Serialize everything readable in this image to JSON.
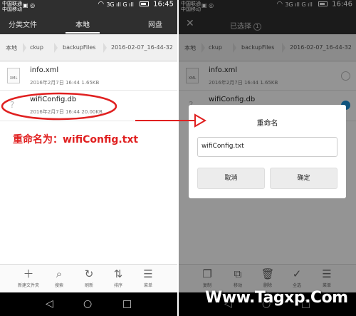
{
  "status": {
    "carrier1": "中国联通",
    "carrier2": "中国移动",
    "signal": "3G ıll G ıll",
    "time_left": "16:45",
    "time_right": "16:46"
  },
  "tabs": [
    {
      "label": "分类文件"
    },
    {
      "label": "本地"
    },
    {
      "label": "网盘"
    }
  ],
  "selection": {
    "title": "已选择",
    "count": "1",
    "close_icon": "close-icon"
  },
  "breadcrumb": [
    "本地",
    "ckup",
    "backupFiles",
    "2016-02-07_16-44-32"
  ],
  "files": [
    {
      "name": "info.xml",
      "meta": "2016年2月7日 16:44 1.65KB",
      "icon_label": "XML"
    },
    {
      "name": "wifiConfig.db",
      "meta": "2016年2月7日 16:44 20.00KB",
      "icon_label": "?"
    }
  ],
  "annotation": {
    "note": "重命名为：wifiConfig.txt",
    "color": "#e02020"
  },
  "toolbar_left": [
    {
      "icon": "plus-icon",
      "label": "新建文件夹"
    },
    {
      "icon": "search-icon",
      "label": "搜索"
    },
    {
      "icon": "refresh-icon",
      "label": "刷新"
    },
    {
      "icon": "sort-icon",
      "label": "排序"
    },
    {
      "icon": "menu-icon",
      "label": "菜单"
    }
  ],
  "toolbar_right": [
    {
      "icon": "copy-icon",
      "label": "复制"
    },
    {
      "icon": "move-icon",
      "label": "移动"
    },
    {
      "icon": "delete-icon",
      "label": "删除"
    },
    {
      "icon": "select-all-icon",
      "label": "全选"
    },
    {
      "icon": "menu-icon",
      "label": "菜单"
    }
  ],
  "dialog": {
    "title": "重命名",
    "input_value": "wifiConfig.txt",
    "cancel": "取消",
    "confirm": "确定"
  },
  "watermark": "Www.Tagxp.Com",
  "colors": {
    "accent": "#1a8fd8",
    "header": "#2f2f2f",
    "annotation": "#e02020"
  }
}
